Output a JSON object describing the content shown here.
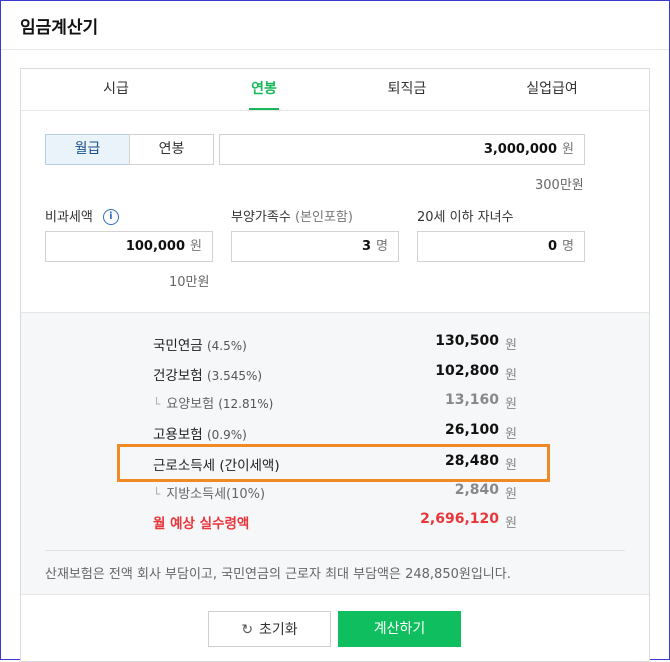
{
  "app": {
    "title": "임금계산기"
  },
  "tabs": [
    {
      "label": "시급"
    },
    {
      "label": "연봉"
    },
    {
      "label": "퇴직금"
    },
    {
      "label": "실업급여"
    }
  ],
  "active_tab": "연봉",
  "mode_toggle": {
    "monthly": "월급",
    "annual": "연봉",
    "selected": "월급"
  },
  "salary": {
    "value": "3,000,000",
    "unit": "원",
    "hint": "300만원"
  },
  "nontaxable": {
    "label": "비과세액",
    "info_icon": "i",
    "value": "100,000",
    "unit": "원",
    "hint": "10만원"
  },
  "dependents": {
    "label": "부양가족수",
    "label_sub": "(본인포함)",
    "value": "3",
    "unit": "명"
  },
  "children": {
    "label": "20세 이하 자녀수",
    "value": "0",
    "unit": "명"
  },
  "results": [
    {
      "label": "국민연금",
      "rate": "(4.5%)",
      "value": "130,500",
      "unit": "원",
      "type": "main"
    },
    {
      "label": "건강보험",
      "rate": "(3.545%)",
      "value": "102,800",
      "unit": "원",
      "type": "main"
    },
    {
      "label": "요양보험",
      "rate": "(12.81%)",
      "value": "13,160",
      "unit": "원",
      "type": "sub"
    },
    {
      "label": "고용보험",
      "rate": "(0.9%)",
      "value": "26,100",
      "unit": "원",
      "type": "main"
    },
    {
      "label": "근로소득세",
      "rate": "(간이세액)",
      "value": "28,480",
      "unit": "원",
      "type": "main",
      "highlighted": true
    },
    {
      "label": "지방소득세",
      "rate": "(10%)",
      "value": "2,840",
      "unit": "원",
      "type": "sub"
    },
    {
      "label": "월 예상 실수령액",
      "rate": "",
      "value": "2,696,120",
      "unit": "원",
      "type": "net"
    }
  ],
  "note": "산재보험은 전액 회사 부담이고, 국민연금의 근로자 최대 부담액은 248,850원입니다.",
  "buttons": {
    "reset": "초기화",
    "calculate": "계산하기"
  },
  "colors": {
    "accent_green": "#19b85a",
    "net_red": "#e8363a",
    "highlight_orange": "#f08a24"
  }
}
